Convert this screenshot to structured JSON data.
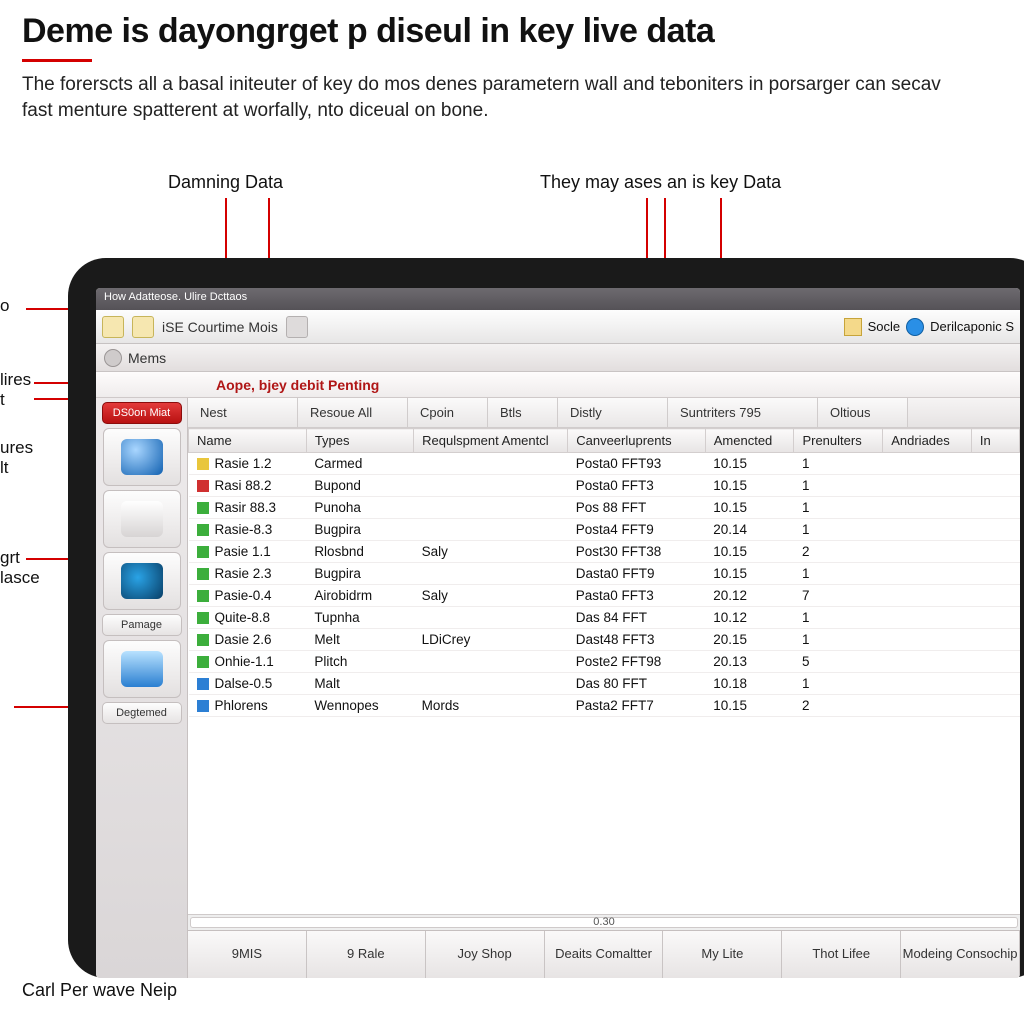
{
  "article": {
    "title": "Deme is dayongrget p diseul in key live data",
    "lead": "The forerscts all a basal initeuter of key do mos denes parametern wall and teboniters in porsarger can secav fast menture spatterent at worfally, nto diceual on bone."
  },
  "callouts": {
    "top_left": "Damning Data",
    "top_right": "They may ases an is key Data",
    "edge_0": "o",
    "edge_1a": "lires",
    "edge_1b": "t",
    "edge_2a": "ures",
    "edge_2b": "lt",
    "edge_3a": "grt",
    "edge_3b": "lasce",
    "bottom": "Carl Per wave Neip"
  },
  "window": {
    "title": "How Adatteose. Ulire Dcttaos",
    "menubar": {
      "item1": "iSE Courtime Mois",
      "right1": "Socle",
      "right2": "Derilcaponic S"
    },
    "tab": "Mems",
    "subheader": "Aope, bjey debit Penting"
  },
  "sidebar": {
    "btn_red": "DS0on Miat",
    "btn_pamage": "Pamage",
    "btn_degtemed": "Degtemed"
  },
  "filterbar": {
    "items": [
      "Nest",
      "Resoue All",
      "Cpoin",
      "Btls",
      "Distly",
      "Suntriters 795",
      "Oltious"
    ]
  },
  "columns": [
    "Name",
    "Types",
    "Requlspment Amentcl",
    "Canveerluprents",
    "Amencted",
    "Prenulters",
    "Andriades",
    "In"
  ],
  "rows": [
    {
      "c": "y",
      "name": "Rasie 1.2",
      "type": "Carmed",
      "req": "",
      "conv": "Posta0 FFT93",
      "am": "10.15",
      "pre": "1",
      "an": ""
    },
    {
      "c": "r",
      "name": "Rasi 88.2",
      "type": "Bupond",
      "req": "",
      "conv": "Posta0 FFT3",
      "am": "10.15",
      "pre": "1",
      "an": ""
    },
    {
      "c": "g",
      "name": "Rasir 88.3",
      "type": "Punoha",
      "req": "",
      "conv": "Pos 88 FFT",
      "am": "10.15",
      "pre": "1",
      "an": ""
    },
    {
      "c": "g",
      "name": "Rasie-8.3",
      "type": "Bugpira",
      "req": "",
      "conv": "Posta4 FFT9",
      "am": "20.14",
      "pre": "1",
      "an": ""
    },
    {
      "c": "g",
      "name": "Pasie 1.1",
      "type": "Rlosbnd",
      "req": "Saly",
      "conv": "Post30 FFT38",
      "am": "10.15",
      "pre": "2",
      "an": ""
    },
    {
      "c": "g",
      "name": "Rasie 2.3",
      "type": "Bugpira",
      "req": "",
      "conv": "Dasta0 FFT9",
      "am": "10.15",
      "pre": "1",
      "an": ""
    },
    {
      "c": "g",
      "name": "Pasie-0.4",
      "type": "Airobidrm",
      "req": "Saly",
      "conv": "Pasta0 FFT3",
      "am": "20.12",
      "pre": "7",
      "an": ""
    },
    {
      "c": "g",
      "name": "Quite-8.8",
      "type": "Tupnha",
      "req": "",
      "conv": "Das 84 FFT",
      "am": "10.12",
      "pre": "1",
      "an": ""
    },
    {
      "c": "g",
      "name": "Dasie 2.6",
      "type": "Melt",
      "req": "LDiCrey",
      "conv": "Dast48 FFT3",
      "am": "20.15",
      "pre": "1",
      "an": ""
    },
    {
      "c": "g",
      "name": "Onhie-1.1",
      "type": "Plitch",
      "req": "",
      "conv": "Poste2 FFT98",
      "am": "20.13",
      "pre": "5",
      "an": ""
    },
    {
      "c": "b",
      "name": "Dalse-0.5",
      "type": "Malt",
      "req": "",
      "conv": "Das 80 FFT",
      "am": "10.18",
      "pre": "1",
      "an": ""
    },
    {
      "c": "b",
      "name": "Phlorens",
      "type": "Wennopes",
      "req": "Mords",
      "conv": "Pasta2 FFT7",
      "am": "10.15",
      "pre": "2",
      "an": ""
    }
  ],
  "hscroll_pos": "0.30",
  "bottomtabs": [
    "9MIS",
    "9 Rale",
    "Joy Shop",
    "Deaits Comaltter",
    "My Lite",
    "Thot Lifee",
    "Modeing Consochip"
  ]
}
